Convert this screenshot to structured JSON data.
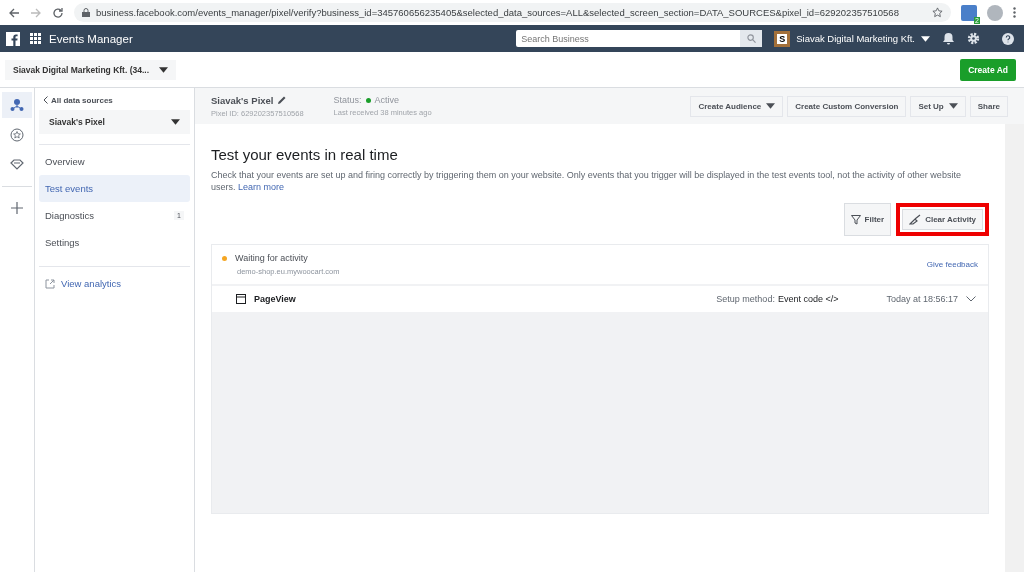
{
  "browser": {
    "url": "business.facebook.com/events_manager/pixel/verify?business_id=345760656235405&selected_data_sources=ALL&selected_screen_section=DATA_SOURCES&pixel_id=629202357510568",
    "extension_badge": "2"
  },
  "header": {
    "app_name": "Events Manager",
    "search": {
      "placeholder": "Search Business"
    },
    "account_initial": "S",
    "account_name": "Siavak Digital Marketing Kft."
  },
  "subheader": {
    "business_selector": "Siavak Digital Marketing Kft. (34...",
    "create_ad": "Create Ad"
  },
  "rail": [
    {
      "selected": true
    },
    {
      "selected": false
    },
    {
      "selected": false
    },
    {
      "selected": false
    }
  ],
  "sidebar": {
    "back_link": "All data sources",
    "source_selector": "Siavak's Pixel",
    "items": [
      {
        "label": "Overview",
        "selected": false
      },
      {
        "label": "Test events",
        "selected": true
      },
      {
        "label": "Diagnostics",
        "selected": false,
        "badge": "1"
      },
      {
        "label": "Settings",
        "selected": false
      }
    ],
    "analytics_link": "View analytics"
  },
  "pixel": {
    "name": "Siavak's Pixel",
    "pixel_id": "Pixel ID: 629202357510568",
    "status_label": "Status:",
    "status": "Active",
    "last_received": "Last received 38 minutes ago"
  },
  "actions": [
    {
      "label": "Create Audience",
      "dropdown": true
    },
    {
      "label": "Create Custom Conversion",
      "dropdown": false
    },
    {
      "label": "Set Up",
      "dropdown": true
    },
    {
      "label": "Share",
      "dropdown": false
    }
  ],
  "content": {
    "title": "Test your events in real time",
    "description": "Check that your events are set up and firing correctly by triggering them on your website. Only events that you trigger will be displayed in the test events tool, not the activity of other website users.",
    "learn_more": "Learn more",
    "filter": "Filter",
    "clear_activity": "Clear Activity",
    "clear_highlighted": true
  },
  "activity": {
    "status": "Waiting for activity",
    "domain": "demo-shop.eu.mywoocart.com",
    "feedback": "Give feedback"
  },
  "events": [
    {
      "name": "PageView",
      "setup_label": "Setup method:",
      "setup_value": "Event code </>",
      "time": "Today at 18:56:17",
      "expanded": false
    }
  ]
}
